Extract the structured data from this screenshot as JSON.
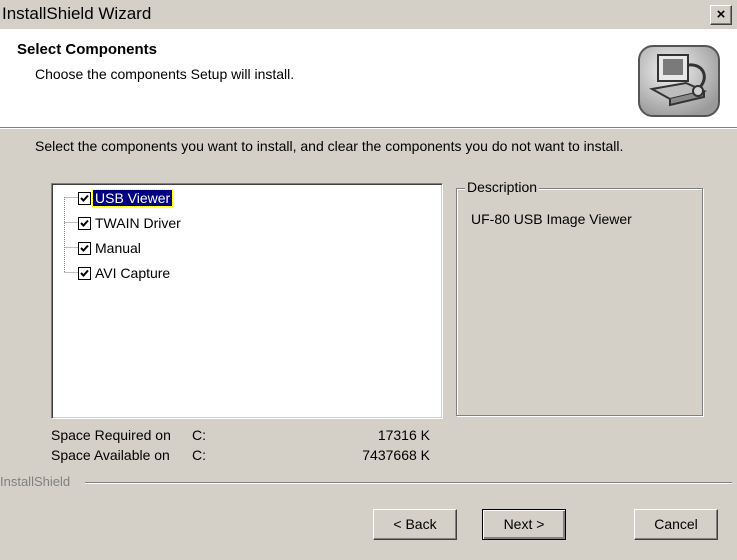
{
  "window": {
    "title": "InstallShield Wizard",
    "close_glyph": "×"
  },
  "header": {
    "title": "Select Components",
    "subtitle": "Choose the components Setup will install.",
    "icon": "computer-install-icon"
  },
  "instructions": "Select the components you want to install, and clear the components you do not want to install.",
  "components": [
    {
      "label": "USB Viewer",
      "checked": true,
      "selected": true
    },
    {
      "label": "TWAIN Driver",
      "checked": true,
      "selected": false
    },
    {
      "label": "Manual",
      "checked": true,
      "selected": false
    },
    {
      "label": "AVI Capture",
      "checked": true,
      "selected": false
    }
  ],
  "description": {
    "legend": "Description",
    "text": "UF-80 USB Image Viewer"
  },
  "space": {
    "required_label": "Space Required on",
    "required_drive": "C:",
    "required_value": "17316 K",
    "available_label": "Space Available on",
    "available_drive": "C:",
    "available_value": "7437668 K"
  },
  "brand": "InstallShield",
  "buttons": {
    "back": "< Back",
    "next": "Next >",
    "cancel": "Cancel"
  }
}
